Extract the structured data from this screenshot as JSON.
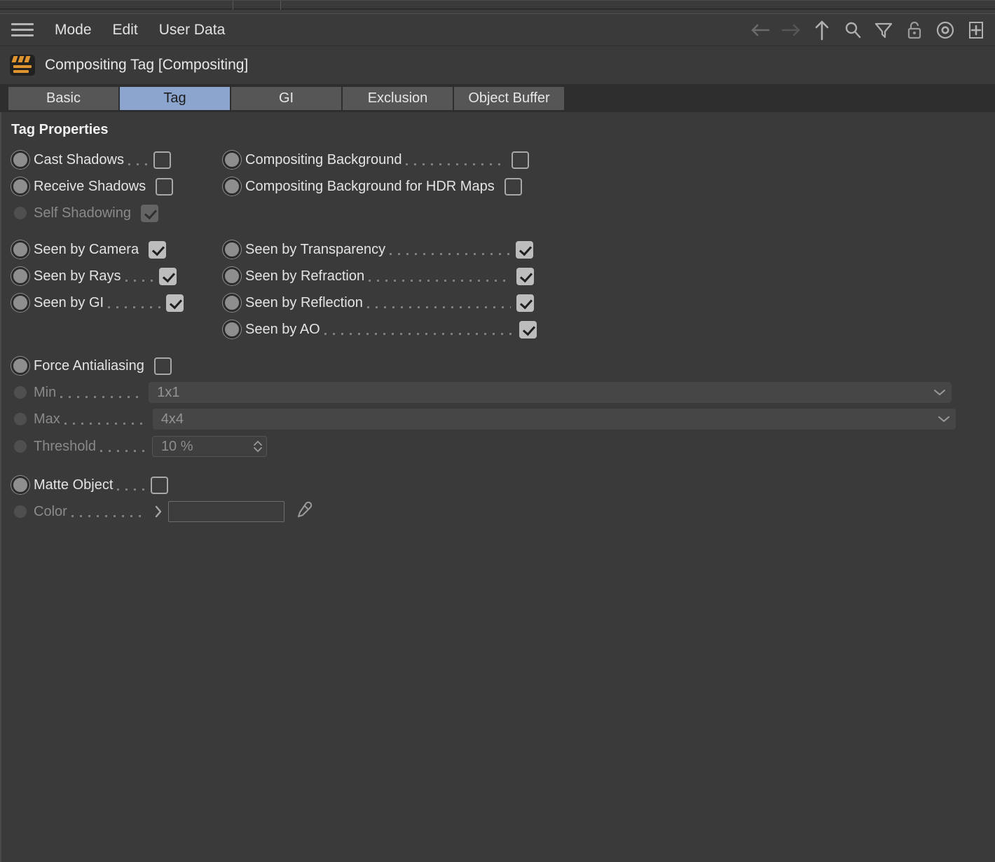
{
  "window": {
    "menus": [
      "Mode",
      "Edit",
      "User Data"
    ],
    "hamburger_icon": "hamburger-icon",
    "toolbar_icons": [
      {
        "name": "back-arrow-icon",
        "glyph": "arrow-left",
        "disabled": true
      },
      {
        "name": "forward-arrow-icon",
        "glyph": "arrow-right",
        "disabled": true
      },
      {
        "name": "up-arrow-icon",
        "glyph": "arrow-up",
        "disabled": false
      },
      {
        "name": "search-icon",
        "glyph": "magnifier",
        "disabled": false
      },
      {
        "name": "filter-icon",
        "glyph": "funnel",
        "disabled": false
      },
      {
        "name": "lock-icon",
        "glyph": "padlock",
        "disabled": false
      },
      {
        "name": "record-icon",
        "glyph": "circle-dot",
        "disabled": false
      },
      {
        "name": "add-panel-icon",
        "glyph": "square-plus",
        "disabled": false
      }
    ]
  },
  "object_header": {
    "icon": "compositing-tag-icon",
    "title": "Compositing Tag [Compositing]"
  },
  "tabs": [
    {
      "label": "Basic",
      "selected": false
    },
    {
      "label": "Tag",
      "selected": true
    },
    {
      "label": "GI",
      "selected": false
    },
    {
      "label": "Exclusion",
      "selected": false
    },
    {
      "label": "Object Buffer",
      "selected": false
    }
  ],
  "group": {
    "title": "Tag Properties"
  },
  "properties": {
    "cast_shadows": {
      "label": "Cast Shadows",
      "checked": false,
      "enabled": true
    },
    "receive_shadows": {
      "label": "Receive Shadows",
      "checked": false,
      "enabled": true
    },
    "self_shadowing": {
      "label": "Self Shadowing",
      "checked": true,
      "enabled": false
    },
    "compositing_background": {
      "label": "Compositing Background",
      "checked": false,
      "enabled": true
    },
    "compositing_background_hdr": {
      "label": "Compositing Background for HDR Maps",
      "checked": false,
      "enabled": true
    },
    "seen_by_camera": {
      "label": "Seen by Camera",
      "checked": true,
      "enabled": true
    },
    "seen_by_rays": {
      "label": "Seen by Rays",
      "checked": true,
      "enabled": true
    },
    "seen_by_gi": {
      "label": "Seen by GI",
      "checked": true,
      "enabled": true
    },
    "seen_by_transparency": {
      "label": "Seen by Transparency",
      "checked": true,
      "enabled": true
    },
    "seen_by_refraction": {
      "label": "Seen by Refraction",
      "checked": true,
      "enabled": true
    },
    "seen_by_reflection": {
      "label": "Seen by Reflection",
      "checked": true,
      "enabled": true
    },
    "seen_by_ao": {
      "label": "Seen by AO",
      "checked": true,
      "enabled": true
    },
    "force_antialiasing": {
      "label": "Force Antialiasing",
      "checked": false,
      "enabled": true
    },
    "min": {
      "label": "Min",
      "value": "1x1",
      "enabled": false
    },
    "max": {
      "label": "Max",
      "value": "4x4",
      "enabled": false
    },
    "threshold": {
      "label": "Threshold",
      "value": "10 %",
      "enabled": false
    },
    "matte_object": {
      "label": "Matte Object",
      "checked": false,
      "enabled": true
    },
    "color": {
      "label": "Color",
      "value": "",
      "enabled": false,
      "picker_icon": "eyedropper-icon",
      "expander_icon": "chevron-right-icon"
    }
  },
  "colors": {
    "panel_bg": "#3a3a3a",
    "tab_selected": "#8ca5ce",
    "tab_unselected": "#565656",
    "text": "#e4e4e4",
    "text_disabled": "#8a8a8a",
    "checkbox_on": "#bdbdbd",
    "tag_icon_accent": "#e0942f"
  }
}
